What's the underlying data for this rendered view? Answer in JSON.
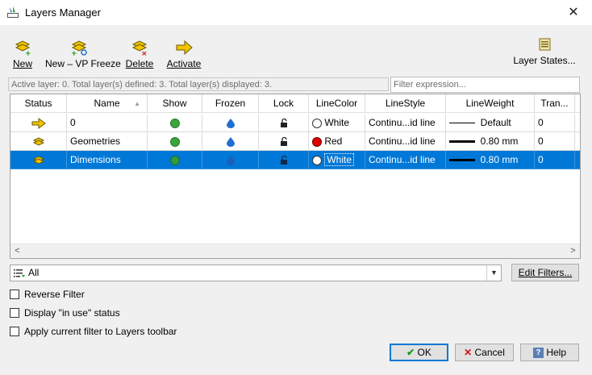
{
  "window": {
    "title": "Layers Manager"
  },
  "toolbar": {
    "new_label": "New",
    "new_vp_label": "New – VP Freeze",
    "delete_label": "Delete",
    "activate_label": "Activate",
    "layer_states_label": "Layer States..."
  },
  "info": {
    "text": "Active layer: 0. Total layer(s) defined: 3. Total layer(s) displayed: 3.",
    "filter_placeholder": "Filter expression..."
  },
  "grid": {
    "columns": [
      "Status",
      "Name",
      "Show",
      "Frozen",
      "Lock",
      "LineColor",
      "LineStyle",
      "LineWeight",
      "Tran..."
    ],
    "rows": [
      {
        "name": "0",
        "status": "arrow-icon",
        "color_name": "White",
        "color_hex": "#ffffff",
        "linestyle": "Continu...id line",
        "lineweight": "Default",
        "transparency": "0",
        "selected": false
      },
      {
        "name": "Geometries",
        "status": "layer-icon",
        "color_name": "Red",
        "color_hex": "#e00000",
        "linestyle": "Continu...id line",
        "lineweight": "0.80 mm",
        "transparency": "0",
        "selected": false
      },
      {
        "name": "Dimensions",
        "status": "layer-icon",
        "color_name": "White",
        "color_hex": "#ffffff",
        "linestyle": "Continu...id line",
        "lineweight": "0.80 mm",
        "transparency": "0",
        "selected": true
      }
    ]
  },
  "filter": {
    "selected": "All",
    "edit_label": "Edit Filters..."
  },
  "options": {
    "reverse_filter": "Reverse Filter",
    "in_use_status": "Display \"in use\" status",
    "apply_filter_toolbar": "Apply current filter to Layers toolbar"
  },
  "buttons": {
    "ok": "OK",
    "cancel": "Cancel",
    "help": "Help"
  },
  "colors": {
    "selection": "#0078d7",
    "show_green": "#3aa53a",
    "frozen_blue": "#1f6fd1"
  }
}
